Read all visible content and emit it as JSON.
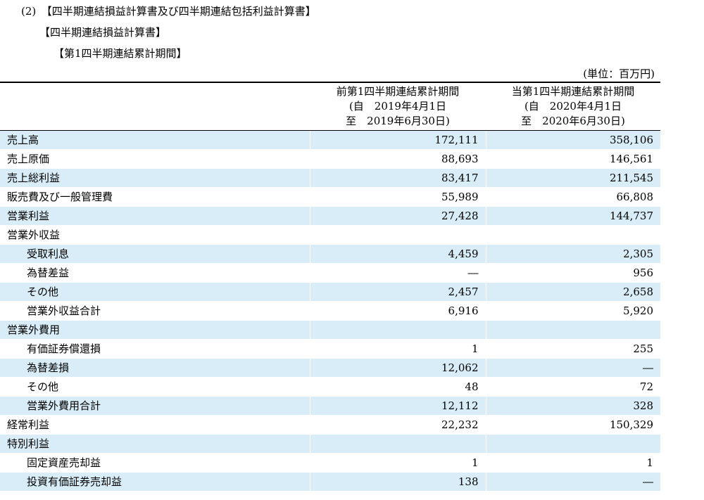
{
  "headings": {
    "section": "(2)　【四半期連結損益計算書及び四半期連結包括利益計算書】",
    "statement": "【四半期連結損益計算書】",
    "period": "【第1四半期連結累計期間】",
    "unit": "(単位：百万円)"
  },
  "columns": {
    "prev": {
      "title": "前第1四半期連結累計期間",
      "from": "(自　2019年4月1日",
      "to": "至　2019年6月30日)"
    },
    "curr": {
      "title": "当第1四半期連結累計期間",
      "from": "(自　2020年4月1日",
      "to": "至　2020年6月30日)"
    }
  },
  "rows": [
    {
      "label": "売上高",
      "prev": "172,111",
      "curr": "358,106"
    },
    {
      "label": "売上原価",
      "prev": "88,693",
      "curr": "146,561"
    },
    {
      "label": "売上総利益",
      "prev": "83,417",
      "curr": "211,545"
    },
    {
      "label": "販売費及び一般管理費",
      "prev": "55,989",
      "curr": "66,808"
    },
    {
      "label": "営業利益",
      "prev": "27,428",
      "curr": "144,737"
    },
    {
      "label": "営業外収益",
      "prev": "",
      "curr": ""
    },
    {
      "label": "受取利息",
      "prev": "4,459",
      "curr": "2,305"
    },
    {
      "label": "為替差益",
      "prev": "―",
      "curr": "956"
    },
    {
      "label": "その他",
      "prev": "2,457",
      "curr": "2,658"
    },
    {
      "label": "営業外収益合計",
      "prev": "6,916",
      "curr": "5,920"
    },
    {
      "label": "営業外費用",
      "prev": "",
      "curr": ""
    },
    {
      "label": "有価証券償還損",
      "prev": "1",
      "curr": "255"
    },
    {
      "label": "為替差損",
      "prev": "12,062",
      "curr": "―"
    },
    {
      "label": "その他",
      "prev": "48",
      "curr": "72"
    },
    {
      "label": "営業外費用合計",
      "prev": "12,112",
      "curr": "328"
    },
    {
      "label": "経常利益",
      "prev": "22,232",
      "curr": "150,329"
    },
    {
      "label": "特別利益",
      "prev": "",
      "curr": ""
    },
    {
      "label": "固定資産売却益",
      "prev": "1",
      "curr": "1"
    },
    {
      "label": "投資有価証券売却益",
      "prev": "138",
      "curr": "―"
    }
  ]
}
